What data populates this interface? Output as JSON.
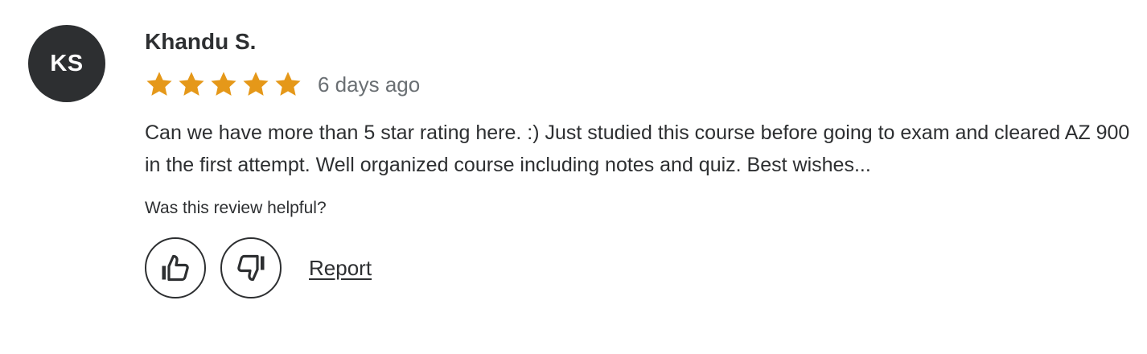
{
  "review": {
    "avatar_initials": "KS",
    "reviewer_name": "Khandu S.",
    "rating": 5,
    "rating_max": 5,
    "date": "6 days ago",
    "text": "Can we have more than 5 star rating here. :) Just studied this course before going to exam and cleared AZ 900 in the first attempt. Well organized course including notes and quiz. Best wishes...",
    "helpful_question": "Was this review helpful?",
    "report_label": "Report"
  },
  "icons": {
    "star": "star-icon",
    "thumbs_up": "thumbs-up-icon",
    "thumbs_down": "thumbs-down-icon"
  },
  "colors": {
    "star": "#e59819",
    "avatar_bg": "#2d2f31",
    "text": "#2d2f31",
    "muted_text": "#6a6f73"
  }
}
